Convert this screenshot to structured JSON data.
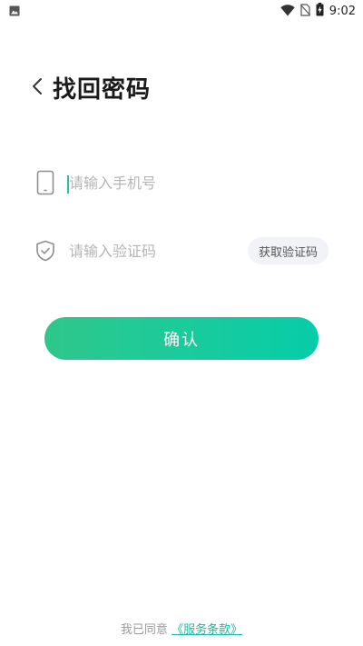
{
  "status_bar": {
    "time": "9:02",
    "icons": [
      "image-notification-icon",
      "wifi-icon",
      "no-sim-icon",
      "battery-charging-icon"
    ]
  },
  "header": {
    "back_icon": "chevron-left-icon",
    "title": "找回密码"
  },
  "form": {
    "phone": {
      "icon": "phone-icon",
      "placeholder": "请输入手机号",
      "value": ""
    },
    "code": {
      "icon": "shield-check-icon",
      "placeholder": "请输入验证码",
      "value": "",
      "get_code_label": "获取验证码"
    }
  },
  "confirm_label": "确认",
  "agreement": {
    "prefix": "我已同意",
    "link_text": "《服务条款》"
  },
  "colors": {
    "accent_start": "#2ec78b",
    "accent_end": "#06cca9",
    "link": "#1bb7a0",
    "title": "#1a1a1a",
    "placeholder": "#b5b5b5"
  }
}
